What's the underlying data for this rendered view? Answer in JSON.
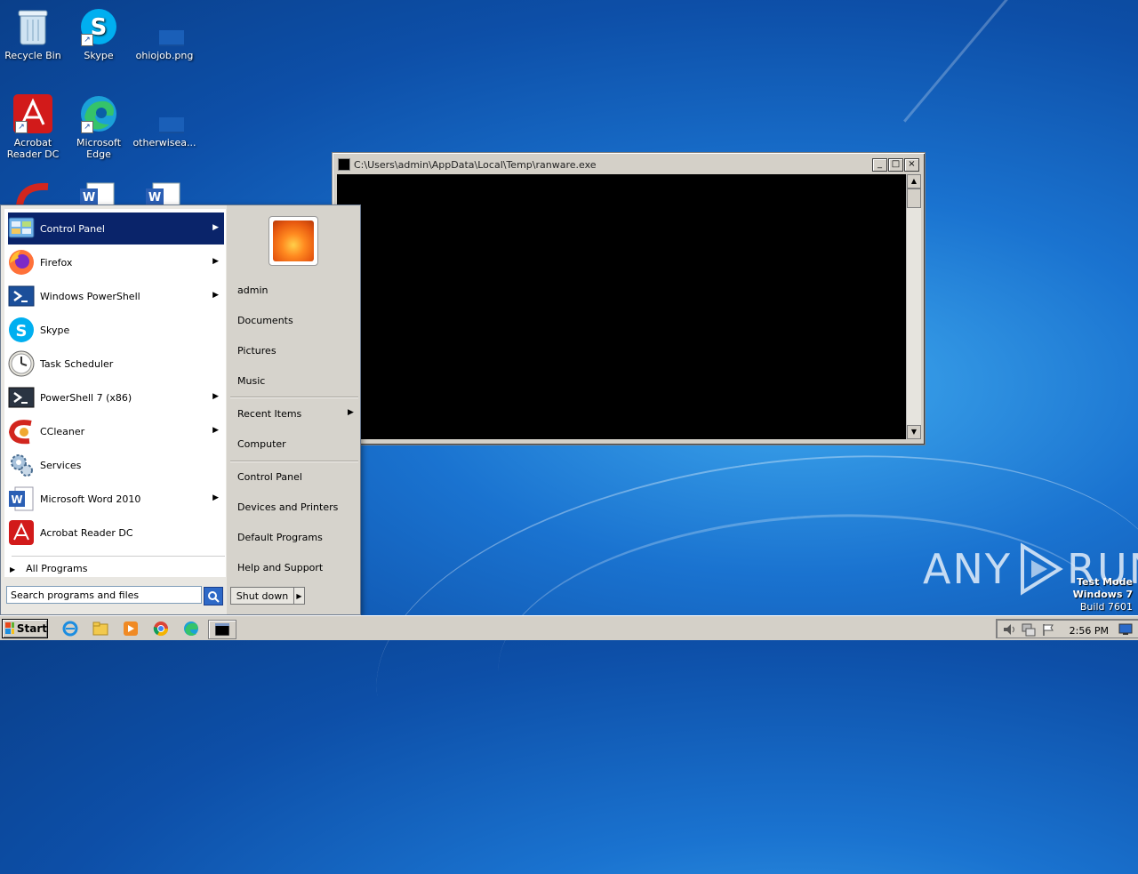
{
  "desktop": {
    "icons": [
      {
        "label": "Recycle Bin",
        "icon": "recycle-bin-icon"
      },
      {
        "label": "Skype",
        "icon": "skype-icon"
      },
      {
        "label": "ohiojob.png",
        "icon": "image-file-icon"
      },
      {
        "label": "Acrobat Reader DC",
        "icon": "acrobat-icon"
      },
      {
        "label": "Microsoft Edge",
        "icon": "edge-icon"
      },
      {
        "label": "otherwisea...",
        "icon": "file-icon"
      }
    ]
  },
  "console_window": {
    "title": "C:\\Users\\admin\\AppData\\Local\\Temp\\ranware.exe",
    "minimize": "_",
    "maximize": "□",
    "close": "×"
  },
  "start_menu": {
    "programs": [
      {
        "label": "Control Panel",
        "icon": "control-panel-icon",
        "submenu": true,
        "selected": true
      },
      {
        "label": "Firefox",
        "icon": "firefox-icon",
        "submenu": true
      },
      {
        "label": "Windows PowerShell",
        "icon": "powershell-icon",
        "submenu": true
      },
      {
        "label": "Skype",
        "icon": "skype-icon",
        "submenu": false
      },
      {
        "label": "Task Scheduler",
        "icon": "clock-icon",
        "submenu": false
      },
      {
        "label": "PowerShell 7 (x86)",
        "icon": "powershell7-icon",
        "submenu": true
      },
      {
        "label": "CCleaner",
        "icon": "ccleaner-icon",
        "submenu": true
      },
      {
        "label": "Services",
        "icon": "gears-icon",
        "submenu": false
      },
      {
        "label": "Microsoft Word 2010",
        "icon": "word-icon",
        "submenu": true
      },
      {
        "label": "Acrobat Reader DC",
        "icon": "acrobat-icon",
        "submenu": false
      }
    ],
    "all_programs": "All Programs",
    "search_placeholder": "Search programs and files",
    "right_items": [
      {
        "label": "admin"
      },
      {
        "label": "Documents"
      },
      {
        "label": "Pictures"
      },
      {
        "label": "Music"
      },
      {
        "label": "Recent Items",
        "submenu": true
      },
      {
        "label": "Computer"
      },
      {
        "label": "Control Panel"
      },
      {
        "label": "Devices and Printers"
      },
      {
        "label": "Default Programs"
      },
      {
        "label": "Help and Support"
      }
    ],
    "shutdown": "Shut down"
  },
  "taskbar": {
    "start_label": "Start",
    "clock": "2:56 PM",
    "pinned": [
      "ie-icon",
      "explorer-icon",
      "media-player-icon",
      "chrome-icon",
      "edge-icon",
      "console-icon"
    ]
  },
  "watermark": {
    "text_left": "ANY",
    "text_right": "RUN"
  },
  "test_mode": {
    "line1": "Test Mode",
    "line2": "Windows 7",
    "line3": "Build 7601"
  }
}
